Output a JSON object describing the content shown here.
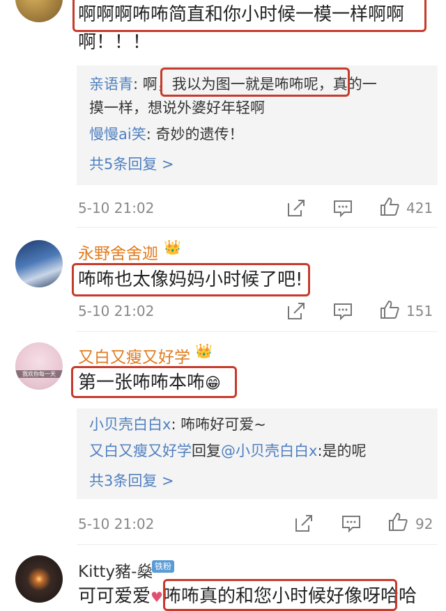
{
  "comments": [
    {
      "text_line1": "啊啊啊咘咘简直和你小时候一模一样啊啊",
      "text_line2": "啊！！！",
      "replies": [
        {
          "user": "亲语青",
          "sep": ": 啊",
          "hl": "，我以为图一就是咘咘呢，",
          "rest": "真的一"
        },
        {
          "cont": "摸一样，想说外婆好年轻啊"
        },
        {
          "user": "慢慢ai笑",
          "text": ": 奇妙的遗传！"
        }
      ],
      "more": "共5条回复 >",
      "time": "5-10 21:02",
      "likes": "421"
    },
    {
      "user": "永野舍舍迦",
      "text": "咘咘也太像妈妈小时候了吧!",
      "time": "5-10 21:02",
      "likes": "151"
    },
    {
      "user": "又白又瘦又好学",
      "text": "第一张咘咘本咘",
      "emoji": "😁",
      "avatar_caption": "我欢你每一天",
      "replies": [
        {
          "user": "小贝壳白白x",
          "text": ": 咘咘好可爱~"
        },
        {
          "user": "又白又瘦又好学",
          "mid": "回复",
          "user2": "@小贝壳白白x",
          "text": ":是的呢"
        }
      ],
      "more": "共3条回复 >",
      "time": "5-10 21:02",
      "likes": "92"
    },
    {
      "user": "Kitty豬-燊",
      "badge": "铁粉",
      "text_pre": "可可爱爱",
      "text_hl": "咘咘真的和您小时候好像呀",
      "text_post": "哈哈"
    }
  ],
  "icons": {
    "share": "share-icon",
    "comment": "comment-icon",
    "like": "thumbs-up-icon",
    "crown": "crown-icon"
  },
  "colors": {
    "highlight": "#c63a2b",
    "username": "#e07b1e",
    "link": "#4f7fbf"
  }
}
